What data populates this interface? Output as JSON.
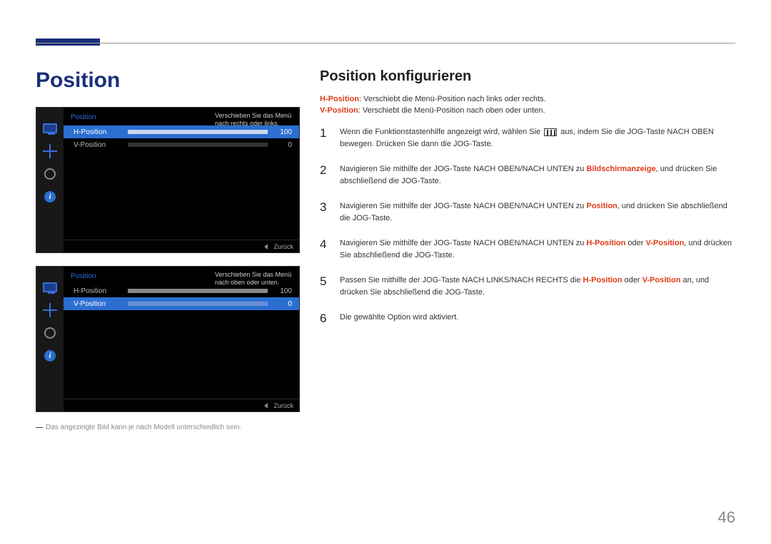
{
  "page_number": "46",
  "section_title": "Position",
  "osd1": {
    "title": "Position",
    "hint": "Verschieben Sie das Menü nach rechts oder links.",
    "rows": [
      {
        "label": "H-Position",
        "value": "100",
        "fill_pct": 100,
        "selected": true
      },
      {
        "label": "V-Position",
        "value": "0",
        "fill_pct": 0,
        "selected": false
      }
    ],
    "back_label": "Zurück"
  },
  "osd2": {
    "title": "Position",
    "hint": "Verschieben Sie das Menü nach oben oder unten.",
    "rows": [
      {
        "label": "H-Position",
        "value": "100",
        "fill_pct": 100,
        "selected": false
      },
      {
        "label": "V-Position",
        "value": "0",
        "fill_pct": 0,
        "selected": true
      }
    ],
    "back_label": "Zurück"
  },
  "disclaimer": "Das angezeigte Bild kann je nach Modell unterschiedlich sein.",
  "sub_title": "Position konfigurieren",
  "desc": {
    "h_label": "H-Position",
    "h_text": ": Verschiebt die Menü-Position nach links oder rechts.",
    "v_label": "V-Position",
    "v_text": ": Verschiebt die Menü-Position nach oben oder unten."
  },
  "steps": [
    {
      "num": "1",
      "pre": "Wenn die Funktionstastenhilfe angezeigt wird, wählen Sie ",
      "post": " aus, indem Sie die JOG-Taste NACH OBEN bewegen. Drücken Sie dann die JOG-Taste."
    },
    {
      "num": "2",
      "pre": "Navigieren Sie mithilfe der JOG-Taste NACH OBEN/NACH UNTEN zu ",
      "red1": "Bildschirmanzeige",
      "post": ", und drücken Sie abschließend die JOG-Taste."
    },
    {
      "num": "3",
      "pre": "Navigieren Sie mithilfe der JOG-Taste NACH OBEN/NACH UNTEN zu ",
      "red1": "Position",
      "post": ", und drücken Sie abschließend die JOG-Taste."
    },
    {
      "num": "4",
      "pre": "Navigieren Sie mithilfe der JOG-Taste NACH OBEN/NACH UNTEN zu ",
      "red1": "H-Position",
      "mid": " oder ",
      "red2": "V-Position",
      "post": ", und drücken Sie abschließend die JOG-Taste."
    },
    {
      "num": "5",
      "pre": "Passen Sie mithilfe der JOG-Taste NACH LINKS/NACH RECHTS die ",
      "red1": "H-Position",
      "mid": " oder ",
      "red2": "V-Position",
      "post": " an, und drücken Sie abschließend die JOG-Taste."
    },
    {
      "num": "6",
      "pre": "Die gewählte Option wird aktiviert."
    }
  ]
}
